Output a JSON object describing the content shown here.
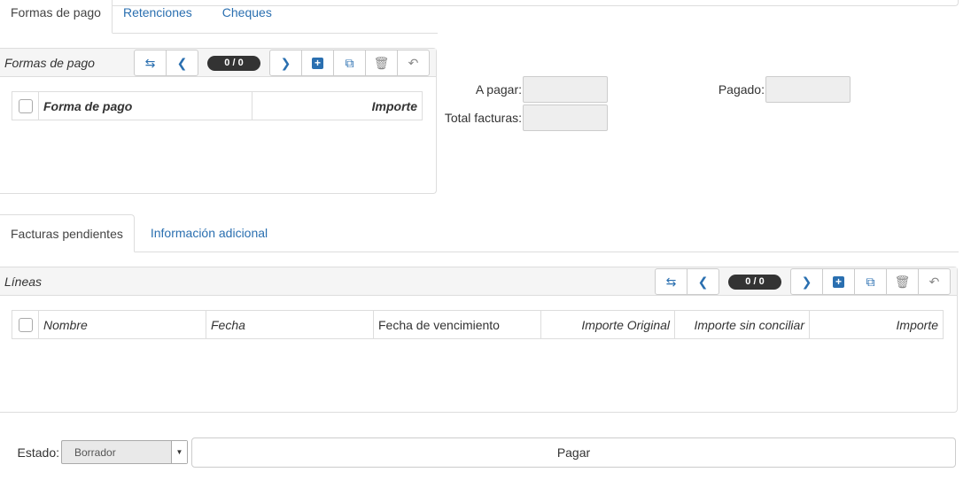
{
  "top_tabs": {
    "formas_de_pago": "Formas de pago",
    "retenciones": "Retenciones",
    "cheques": "Cheques"
  },
  "payments_panel": {
    "title": "Formas de pago",
    "counter": "0 / 0",
    "columns": [
      "Forma de pago",
      "Importe"
    ]
  },
  "fields": {
    "a_pagar_label": "A pagar:",
    "pagado_label": "Pagado:",
    "total_facturas_label": "Total facturas:"
  },
  "mid_tabs": {
    "facturas_pendientes": "Facturas pendientes",
    "informacion_adicional": "Información adicional"
  },
  "lines_panel": {
    "title": "Líneas",
    "counter": "0 / 0",
    "columns": [
      "Nombre",
      "Fecha",
      "Fecha de vencimiento",
      "Importe Original",
      "Importe sin conciliar",
      "Importe"
    ]
  },
  "footer": {
    "estado_label": "Estado:",
    "estado_value": "Borrador",
    "pay_button": "Pagar"
  },
  "icons": {
    "switch": "switch-view-icon",
    "prev": "chevron-left-icon",
    "next": "chevron-right-icon",
    "new": "plus-square-icon",
    "open": "external-link-icon",
    "delete": "trash-icon",
    "undo": "undo-icon"
  },
  "colors": {
    "link": "#2a6fb0",
    "counter_bg": "#333333"
  }
}
